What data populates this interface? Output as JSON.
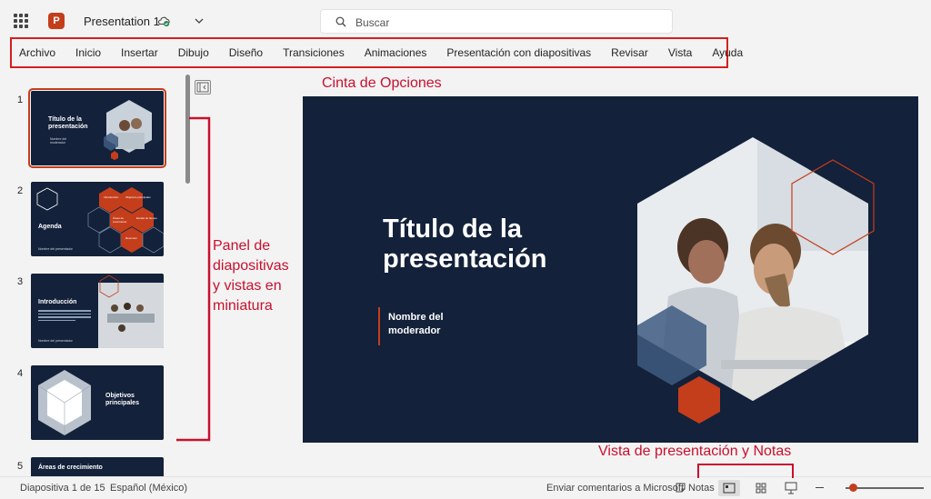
{
  "titlebar": {
    "app_icon": "powerpoint-icon",
    "app_icon_letter": "P",
    "doc_title": "Presentation 1",
    "saved_icon": "cloud-check-icon",
    "dropdown_icon": "chevron-down-icon"
  },
  "search": {
    "placeholder": "Buscar",
    "icon": "search-icon"
  },
  "ribbon": {
    "tabs": [
      {
        "label": "Archivo"
      },
      {
        "label": "Inicio"
      },
      {
        "label": "Insertar"
      },
      {
        "label": "Dibujo"
      },
      {
        "label": "Diseño"
      },
      {
        "label": "Transiciones"
      },
      {
        "label": "Animaciones"
      },
      {
        "label": "Presentación con diapositivas"
      },
      {
        "label": "Revisar"
      },
      {
        "label": "Vista"
      },
      {
        "label": "Ayuda"
      }
    ]
  },
  "annotations": {
    "ribbon": "Cinta de Opciones",
    "panel_lines": [
      "Panel de",
      "diapositivas",
      "y vistas en",
      "miniatura"
    ],
    "views": "Vista de presentación y Notas"
  },
  "thumbnails": [
    {
      "num": "1",
      "title_lines": [
        "Título de la",
        "presentación"
      ],
      "sub": "Nombre del moderador",
      "selected": true
    },
    {
      "num": "2",
      "title_lines": [
        "Agenda"
      ],
      "hex_labels": [
        "Introducción",
        "Objetivos principales",
        "Áreas de crecimiento",
        "Escala de tiempo",
        "Resumen"
      ],
      "footer": "Nombre del presentador"
    },
    {
      "num": "3",
      "title_lines": [
        "Introducción"
      ],
      "footer": "Nombre del presentador"
    },
    {
      "num": "4",
      "title_lines": [
        "Objetivos",
        "principales"
      ]
    },
    {
      "num": "5",
      "title_lines": [
        "Áreas de crecimiento"
      ]
    }
  ],
  "slide": {
    "title_lines": [
      "Título de la",
      "presentación"
    ],
    "subtitle_lines": [
      "Nombre del",
      "moderador"
    ],
    "colors": {
      "background": "#13213a",
      "accent": "#c43e1c",
      "hex_blue": "#3e5a80"
    }
  },
  "statusbar": {
    "slide_counter": "Diapositiva 1 de 15",
    "language": "Español (México)",
    "feedback": "Enviar comentarios a Microsoft",
    "notes_label": "Notas",
    "notes_icon": "notes-icon",
    "normal_view_icon": "normal-view-icon",
    "sorter_view_icon": "slide-sorter-icon",
    "presenter_view_icon": "presentation-view-icon"
  }
}
